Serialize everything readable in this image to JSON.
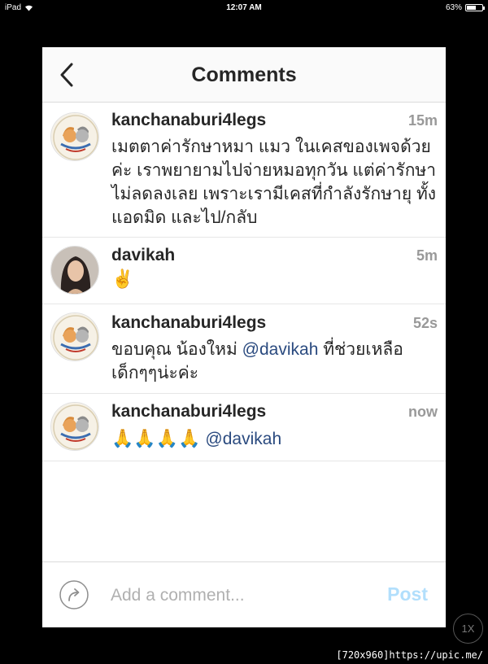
{
  "status_bar": {
    "device": "iPad",
    "time": "12:07 AM",
    "battery": "63%",
    "battery_level": 0.63
  },
  "header": {
    "title": "Comments"
  },
  "comments": [
    {
      "username": "kanchanaburi4legs",
      "time": "15m",
      "text": "เมตตาค่ารักษาหมา แมว ในเคสของเพจด้วยค่ะ เราพยายามไปจ่ายหมอทุกวัน แต่ค่ารักษาไม่ลดลงเลย เพราะเรามีเคสที่กำลังรักษายุ ทั้งแอดมิด และไป/กลับ"
    },
    {
      "username": "davikah",
      "time": "5m",
      "text": "✌️"
    },
    {
      "username": "kanchanaburi4legs",
      "time": "52s",
      "text_before": "ขอบคุณ น้องใหม่ ",
      "mention": "@davikah",
      "text_after": "  ที่ช่วยเหลือเด็กๆๆน่ะค่ะ"
    },
    {
      "username": "kanchanaburi4legs",
      "time": "now",
      "emojis": "🙏🙏🙏🙏",
      "mention": "@davikah"
    }
  ],
  "input": {
    "placeholder": "Add a comment...",
    "post_label": "Post"
  },
  "overlay": {
    "zoom_label": "1X",
    "watermark": "[720x960]https://upic.me/"
  },
  "colors": {
    "mention": "#2a4a7f",
    "post_disabled": "#b2dffc",
    "time": "#999999"
  }
}
